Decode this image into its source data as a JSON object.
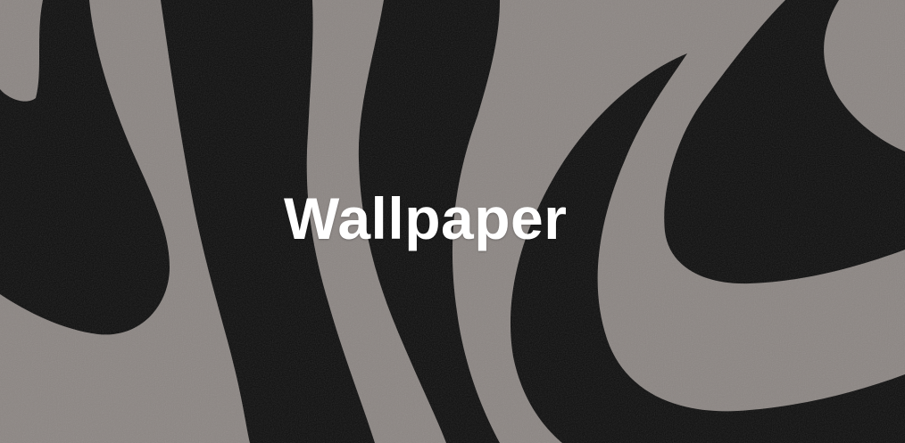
{
  "banner": {
    "title": "Wallpaper",
    "background_pattern": "black-and-gray-swirl-pattern",
    "colors": {
      "dark": "#0c0c0c",
      "light": "#8b8582",
      "title": "#ffffff"
    }
  }
}
